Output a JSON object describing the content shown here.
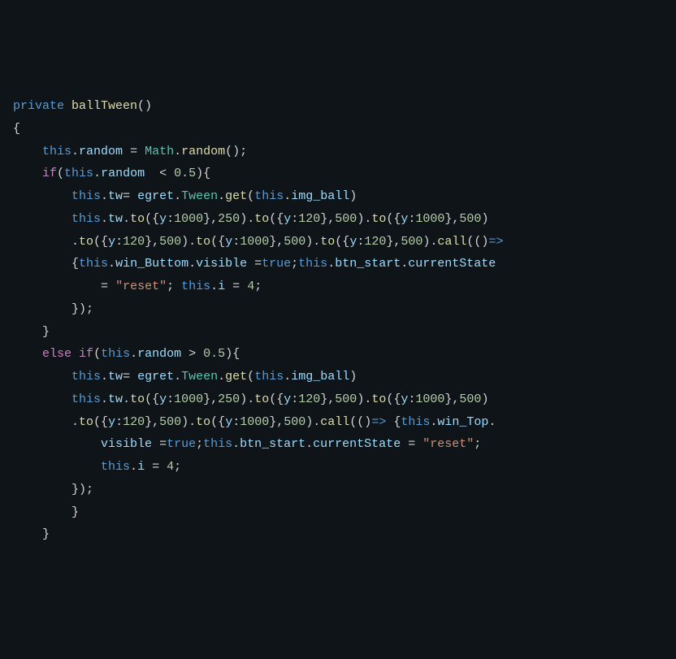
{
  "tokens": {
    "private": "private",
    "ballTween": "ballTween",
    "this": "this",
    "random": "random",
    "Math": "Math",
    "if": "if",
    "lt": "<",
    "gt": ">",
    "n05": "0.5",
    "tw": "tw",
    "egret": "egret",
    "Tween": "Tween",
    "get": "get",
    "img_ball": "img_ball",
    "to": "to",
    "y": "y",
    "n1000": "1000",
    "n250": "250",
    "n120": "120",
    "n500": "500",
    "call": "call",
    "win_Buttom": "win_Buttom",
    "win_Top": "win_Top",
    "visible": "visible",
    "true": "true",
    "btn_start": "btn_start",
    "currentState": "currentState",
    "reset": "\"reset\"",
    "i": "i",
    "n4": "4",
    "else": "else"
  }
}
